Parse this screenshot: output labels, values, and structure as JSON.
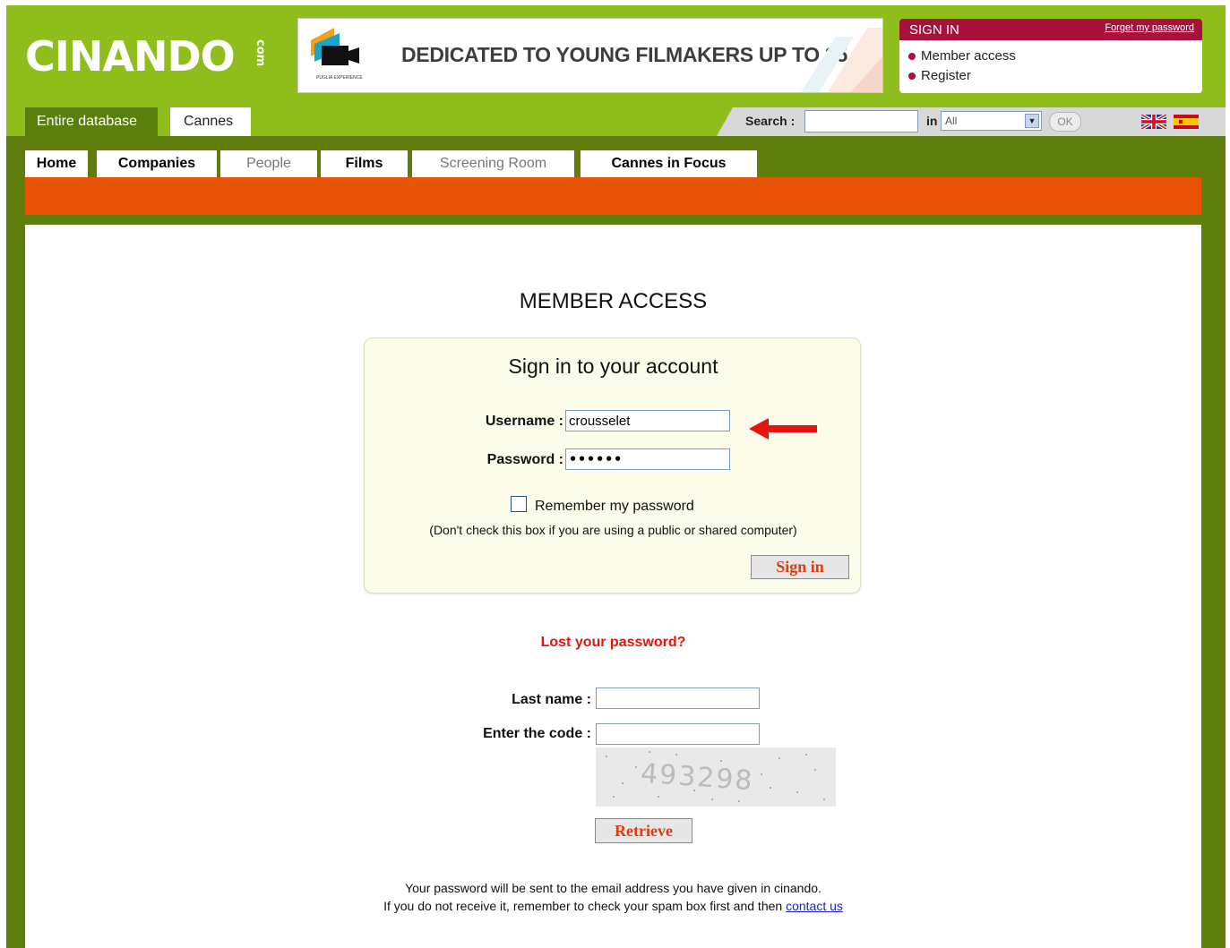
{
  "header": {
    "logo_text": "CINANDO",
    "logo_suffix": "com",
    "banner": {
      "logo_caption": "PUGLIA EXPERIENCE",
      "text": "DEDICATED TO  YOUNG FILMAKERS UP TO 35"
    },
    "signin": {
      "title": "SIGN IN",
      "forget_link": "Forget my password",
      "member_access": "Member access",
      "register": "Register"
    }
  },
  "scope_tabs": [
    "Entire database",
    "Cannes"
  ],
  "search": {
    "label": "Search :",
    "value": "",
    "in_label": "in",
    "scope_selected": "All",
    "ok_label": "OK"
  },
  "languages": [
    "uk-flag-icon",
    "spain-flag-icon"
  ],
  "nav": [
    "Home",
    "Companies",
    "People",
    "Films",
    "Screening Room",
    "Cannes in Focus"
  ],
  "colors": {
    "lime": "#8ebd1c",
    "dark_green": "#5e7f0d",
    "orange": "#e85207",
    "signin_red": "#a8123a",
    "link_red": "#e6140e"
  },
  "main": {
    "title": "MEMBER ACCESS",
    "login": {
      "title": "Sign in to your account",
      "username_label": "Username :",
      "username_value": "crousselet",
      "password_label": "Password :",
      "password_value": "••••••",
      "remember_label": "Remember my password",
      "remember_note": "(Don't check this box if you are using a public or shared computer)",
      "signin_button": "Sign in"
    },
    "lost": {
      "link": "Lost your password?",
      "lastname_label": "Last name :",
      "lastname_value": "",
      "code_label": "Enter the code :",
      "code_value": "",
      "captcha_code": "493298",
      "retrieve_button": "Retrieve"
    },
    "footer_line1": "Your password will be sent to the email address you have given in cinando.",
    "footer_line2": "If you do not receive it, remember to check your spam box first and then",
    "contact_link": "contact us"
  }
}
